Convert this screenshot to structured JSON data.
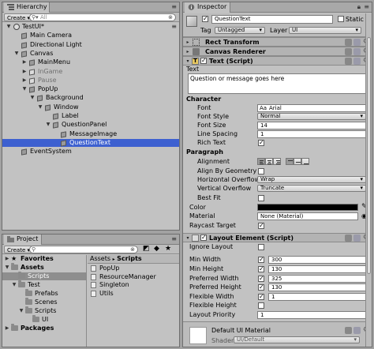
{
  "hierarchy": {
    "tab_label": "Hierarchy",
    "create_label": "Create",
    "search_placeholder": "All",
    "items": [
      {
        "label": "TestUI*",
        "depth": 0,
        "expanded": true,
        "kind": "scene"
      },
      {
        "label": "Main Camera",
        "depth": 1,
        "kind": "obj"
      },
      {
        "label": "Directional Light",
        "depth": 1,
        "kind": "obj"
      },
      {
        "label": "Canvas",
        "depth": 1,
        "expanded": true,
        "kind": "obj"
      },
      {
        "label": "MainMenu",
        "depth": 2,
        "collapsed": true,
        "kind": "obj"
      },
      {
        "label": "InGame",
        "depth": 2,
        "collapsed": true,
        "kind": "obj",
        "inactive": true
      },
      {
        "label": "Pause",
        "depth": 2,
        "collapsed": true,
        "kind": "obj",
        "inactive": true
      },
      {
        "label": "PopUp",
        "depth": 2,
        "expanded": true,
        "kind": "obj"
      },
      {
        "label": "Background",
        "depth": 3,
        "expanded": true,
        "kind": "obj"
      },
      {
        "label": "Window",
        "depth": 4,
        "expanded": true,
        "kind": "obj"
      },
      {
        "label": "Label",
        "depth": 5,
        "kind": "obj"
      },
      {
        "label": "QuestionPanel",
        "depth": 5,
        "expanded": true,
        "kind": "obj"
      },
      {
        "label": "MessageImage",
        "depth": 6,
        "kind": "obj"
      },
      {
        "label": "QuestionText",
        "depth": 6,
        "kind": "obj",
        "selected": true
      },
      {
        "label": "EventSystem",
        "depth": 1,
        "kind": "obj"
      }
    ]
  },
  "project": {
    "tab_label": "Project",
    "create_label": "Create",
    "tree": [
      {
        "label": "Favorites",
        "depth": 0,
        "bold": true,
        "kind": "star"
      },
      {
        "label": "Assets",
        "depth": 0,
        "bold": true,
        "kind": "folder",
        "expanded": true
      },
      {
        "label": "Scripts",
        "depth": 1,
        "kind": "folder",
        "selected": true
      },
      {
        "label": "Test",
        "depth": 1,
        "kind": "folder",
        "expanded": true
      },
      {
        "label": "Prefabs",
        "depth": 2,
        "kind": "folder"
      },
      {
        "label": "Scenes",
        "depth": 2,
        "kind": "folder"
      },
      {
        "label": "Scripts",
        "depth": 2,
        "kind": "folder",
        "expanded": true
      },
      {
        "label": "UI",
        "depth": 3,
        "kind": "folder"
      },
      {
        "label": "Packages",
        "depth": 0,
        "bold": true,
        "kind": "folder",
        "collapsed": true
      }
    ],
    "breadcrumb": [
      "Assets",
      "Scripts"
    ],
    "breadcrumb_sep": "▸",
    "files": [
      "PopUp",
      "ResourceManager",
      "Singleton",
      "Utils"
    ]
  },
  "inspector": {
    "tab_label": "Inspector",
    "object_name": "QuestionText",
    "static_label": "Static",
    "tag_label": "Tag",
    "tag_value": "Untagged",
    "layer_label": "Layer",
    "layer_value": "UI",
    "components": {
      "rect_transform": "Rect Transform",
      "canvas_renderer": "Canvas Renderer",
      "text_script": "Text (Script)",
      "layout_element": "Layout Element (Script)"
    },
    "text": {
      "text_label": "Text",
      "text_value": "Question or message goes here",
      "character_header": "Character",
      "font_label": "Font",
      "font_value": "Arial",
      "font_style_label": "Font Style",
      "font_style_value": "Normal",
      "font_size_label": "Font Size",
      "font_size_value": "14",
      "line_spacing_label": "Line Spacing",
      "line_spacing_value": "1",
      "rich_text_label": "Rich Text",
      "paragraph_header": "Paragraph",
      "alignment_label": "Alignment",
      "align_by_geometry_label": "Align By Geometry",
      "horizontal_overflow_label": "Horizontal Overflow",
      "horizontal_overflow_value": "Wrap",
      "vertical_overflow_label": "Vertical Overflow",
      "vertical_overflow_value": "Truncate",
      "best_fit_label": "Best Fit",
      "color_label": "Color",
      "color_value": "#000000",
      "material_label": "Material",
      "material_value": "None (Material)",
      "raycast_target_label": "Raycast Target"
    },
    "layout_element": {
      "ignore_layout_label": "Ignore Layout",
      "min_width_label": "Min Width",
      "min_width_value": "300",
      "min_height_label": "Min Height",
      "min_height_value": "130",
      "preferred_width_label": "Preferred Width",
      "preferred_width_value": "325",
      "preferred_height_label": "Preferred Height",
      "preferred_height_value": "130",
      "flexible_width_label": "Flexible Width",
      "flexible_width_value": "1",
      "flexible_height_label": "Flexible Height",
      "layout_priority_label": "Layout Priority",
      "layout_priority_value": "1"
    },
    "material_footer": {
      "name": "Default UI Material",
      "shader_label": "Shader",
      "shader_value": "UI/Default"
    }
  },
  "colors": {
    "selection": "#3d60d0",
    "panel_bg": "#c2c2c2",
    "window_bg": "#a2a2a2"
  }
}
